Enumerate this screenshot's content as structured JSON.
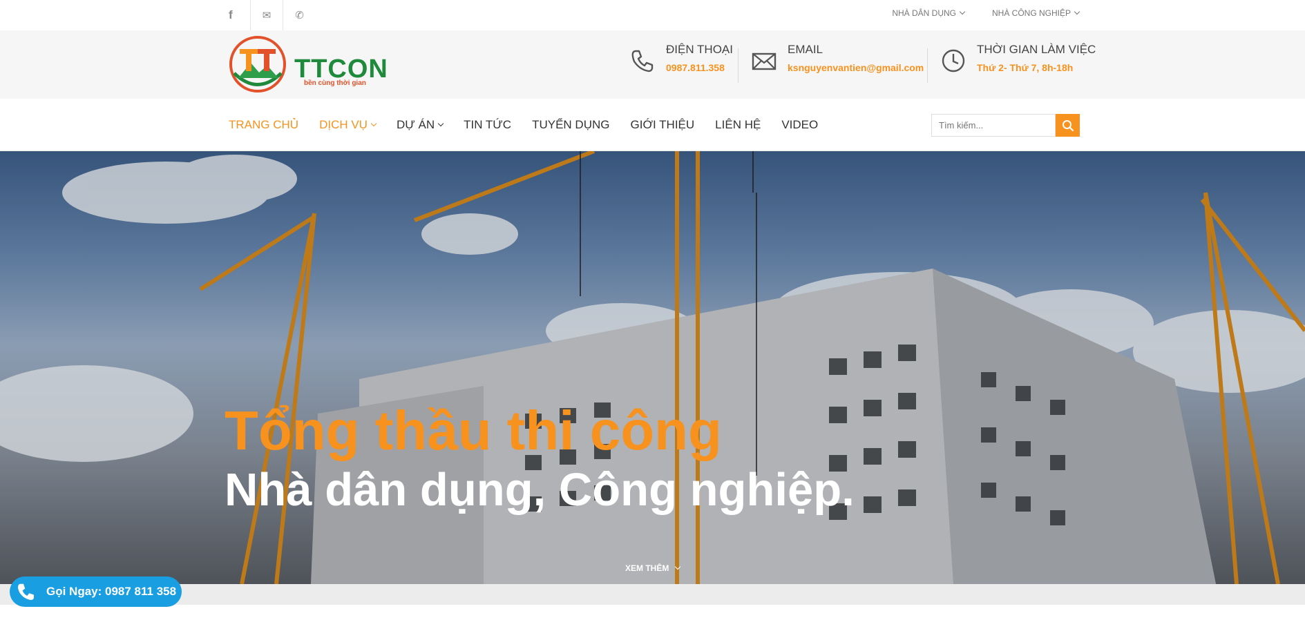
{
  "topbar": {
    "social": [
      {
        "icon": "facebook-icon",
        "glyph": "f"
      },
      {
        "icon": "mail-icon",
        "glyph": "✉"
      },
      {
        "icon": "phone-icon",
        "glyph": "✆"
      }
    ],
    "menu": [
      {
        "label": "NHÀ DÂN DỤNG"
      },
      {
        "label": "NHÀ CÔNG NGHIỆP"
      }
    ]
  },
  "header": {
    "brand": "TTCON",
    "tagline": "bền cùng thời gian",
    "phone": {
      "title": "ĐIỆN THOẠI",
      "value": "0987.811.358"
    },
    "email": {
      "title": "EMAIL",
      "value": "ksnguyenvantien@gmail.com"
    },
    "hours": {
      "title": "THỜI GIAN LÀM VIỆC",
      "value": "Thứ 2- Thứ 7, 8h-18h"
    }
  },
  "nav": {
    "items": [
      {
        "label": "TRANG CHỦ",
        "active": true,
        "dropdown": false
      },
      {
        "label": "DỊCH VỤ",
        "active": true,
        "dropdown": true
      },
      {
        "label": "DỰ ÁN",
        "active": false,
        "dropdown": true
      },
      {
        "label": "TIN TỨC",
        "active": false,
        "dropdown": false
      },
      {
        "label": "TUYỂN DỤNG",
        "active": false,
        "dropdown": false
      },
      {
        "label": "GIỚI THIỆU",
        "active": false,
        "dropdown": false
      },
      {
        "label": "LIÊN HỆ",
        "active": false,
        "dropdown": false
      },
      {
        "label": "VIDEO",
        "active": false,
        "dropdown": false
      }
    ],
    "search_placeholder": "Tìm kiếm..."
  },
  "hero": {
    "headline": "Tổng thầu thi công",
    "subheadline": "Nhà dân dụng, Công nghiệp.",
    "more_label": "XEM THÊM"
  },
  "call_button": {
    "label": "Gọi Ngay: 0987 811 358"
  },
  "colors": {
    "accent": "#f7921e",
    "brand_green": "#1f8a3b",
    "call_blue": "#1a9ee2"
  }
}
